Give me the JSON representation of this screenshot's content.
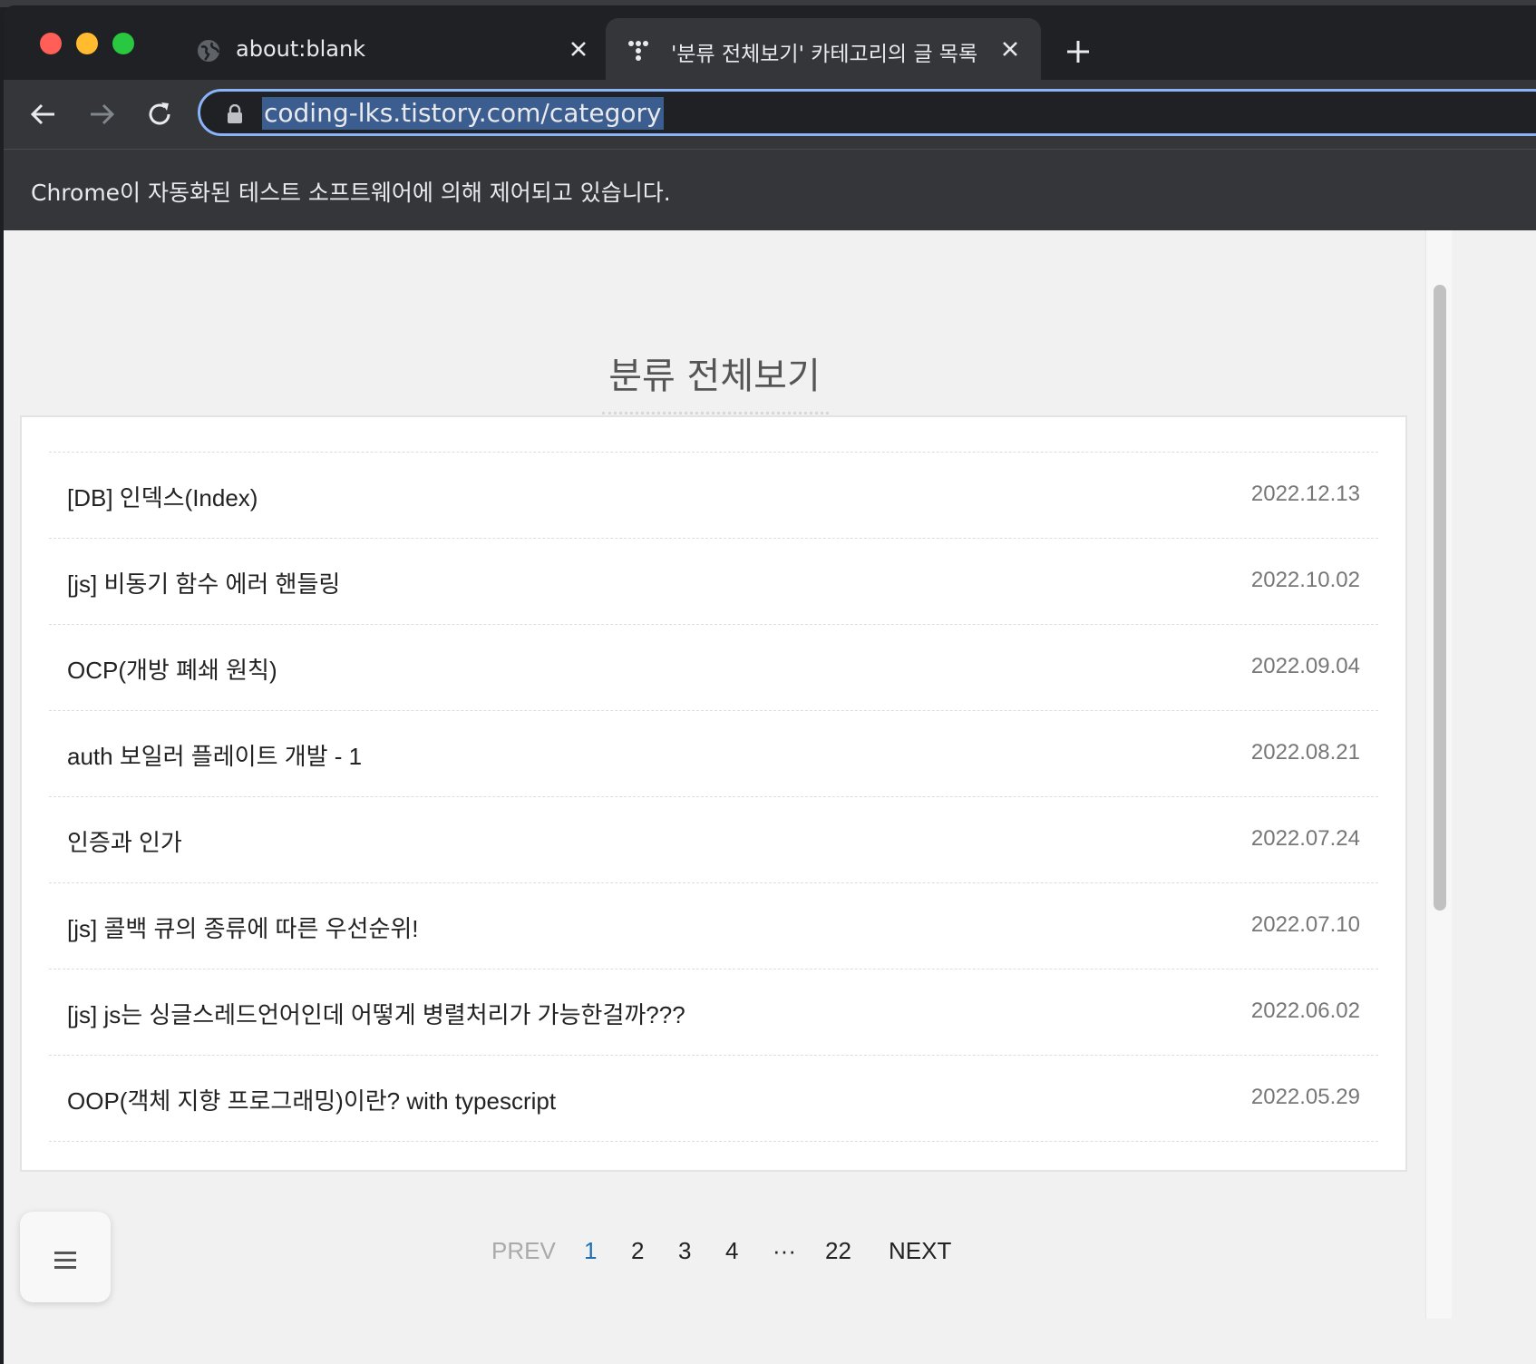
{
  "browser": {
    "tabs": [
      {
        "title": "about:blank",
        "icon": "globe-icon"
      },
      {
        "title": "'분류 전체보기' 카테고리의 글 목록 :",
        "icon": "tistory-icon"
      }
    ],
    "url": "coding-lks.tistory.com/category",
    "infobar": "Chrome이 자동화된 테스트 소프트웨어에 의해 제어되고 있습니다."
  },
  "page": {
    "title": "분류 전체보기",
    "posts": [
      {
        "title": "[DB] 인덱스(Index)",
        "date": "2022.12.13"
      },
      {
        "title": "[js] 비동기 함수 에러 핸들링",
        "date": "2022.10.02"
      },
      {
        "title": "OCP(개방 폐쇄 원칙)",
        "date": "2022.09.04"
      },
      {
        "title": "auth 보일러 플레이트 개발 - 1",
        "date": "2022.08.21"
      },
      {
        "title": "인증과 인가",
        "date": "2022.07.24"
      },
      {
        "title": "[js] 콜백 큐의 종류에 따른 우선순위!",
        "date": "2022.07.10"
      },
      {
        "title": "[js] js는 싱글스레드언어인데 어떻게 병렬처리가 가능한걸까???",
        "date": "2022.06.02"
      },
      {
        "title": "OOP(객체 지향 프로그래밍)이란? with typescript",
        "date": "2022.05.29"
      }
    ],
    "pagination": {
      "prev": "PREV",
      "pages": [
        "1",
        "2",
        "3",
        "4"
      ],
      "ellipsis": "···",
      "last": "22",
      "next": "NEXT",
      "current": "1"
    }
  },
  "colors": {
    "accent": "#8ab4f8",
    "current_page": "#1f6fb2"
  }
}
